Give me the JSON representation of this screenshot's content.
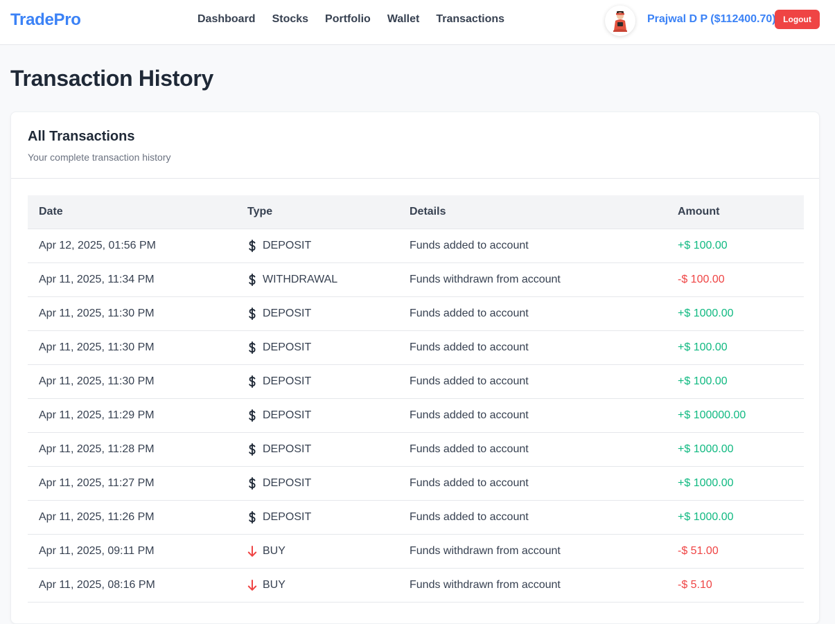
{
  "nav": {
    "brand": "TradePro",
    "links": [
      "Dashboard",
      "Stocks",
      "Portfolio",
      "Wallet",
      "Transactions"
    ],
    "user": "Prajwal D P ($112400.70)",
    "logout_label": "Logout"
  },
  "page": {
    "title": "Transaction History"
  },
  "card": {
    "title": "All Transactions",
    "subtitle": "Your complete transaction history"
  },
  "table": {
    "headers": [
      "Date",
      "Type",
      "Details",
      "Amount"
    ],
    "rows": [
      {
        "date": "Apr 12, 2025, 01:56 PM",
        "icon": "dollar-icon",
        "type": "DEPOSIT",
        "details": "Funds added to account",
        "amount": "+$ 100.00",
        "sign": "pos"
      },
      {
        "date": "Apr 11, 2025, 11:34 PM",
        "icon": "dollar-icon",
        "type": "WITHDRAWAL",
        "details": "Funds withdrawn from account",
        "amount": "-$ 100.00",
        "sign": "neg"
      },
      {
        "date": "Apr 11, 2025, 11:30 PM",
        "icon": "dollar-icon",
        "type": "DEPOSIT",
        "details": "Funds added to account",
        "amount": "+$ 1000.00",
        "sign": "pos"
      },
      {
        "date": "Apr 11, 2025, 11:30 PM",
        "icon": "dollar-icon",
        "type": "DEPOSIT",
        "details": "Funds added to account",
        "amount": "+$ 100.00",
        "sign": "pos"
      },
      {
        "date": "Apr 11, 2025, 11:30 PM",
        "icon": "dollar-icon",
        "type": "DEPOSIT",
        "details": "Funds added to account",
        "amount": "+$ 100.00",
        "sign": "pos"
      },
      {
        "date": "Apr 11, 2025, 11:29 PM",
        "icon": "dollar-icon",
        "type": "DEPOSIT",
        "details": "Funds added to account",
        "amount": "+$ 100000.00",
        "sign": "pos"
      },
      {
        "date": "Apr 11, 2025, 11:28 PM",
        "icon": "dollar-icon",
        "type": "DEPOSIT",
        "details": "Funds added to account",
        "amount": "+$ 1000.00",
        "sign": "pos"
      },
      {
        "date": "Apr 11, 2025, 11:27 PM",
        "icon": "dollar-icon",
        "type": "DEPOSIT",
        "details": "Funds added to account",
        "amount": "+$ 1000.00",
        "sign": "pos"
      },
      {
        "date": "Apr 11, 2025, 11:26 PM",
        "icon": "dollar-icon",
        "type": "DEPOSIT",
        "details": "Funds added to account",
        "amount": "+$ 1000.00",
        "sign": "pos"
      },
      {
        "date": "Apr 11, 2025, 09:11 PM",
        "icon": "arrow-down-icon",
        "type": "BUY",
        "details": "Funds withdrawn from account",
        "amount": "-$ 51.00",
        "sign": "neg"
      },
      {
        "date": "Apr 11, 2025, 08:16 PM",
        "icon": "arrow-down-icon",
        "type": "BUY",
        "details": "Funds withdrawn from account",
        "amount": "-$ 5.10",
        "sign": "neg"
      }
    ]
  },
  "colors": {
    "brand": "#3b82f6",
    "positive": "#10b981",
    "negative": "#ef4444",
    "logout": "#ef4444"
  }
}
